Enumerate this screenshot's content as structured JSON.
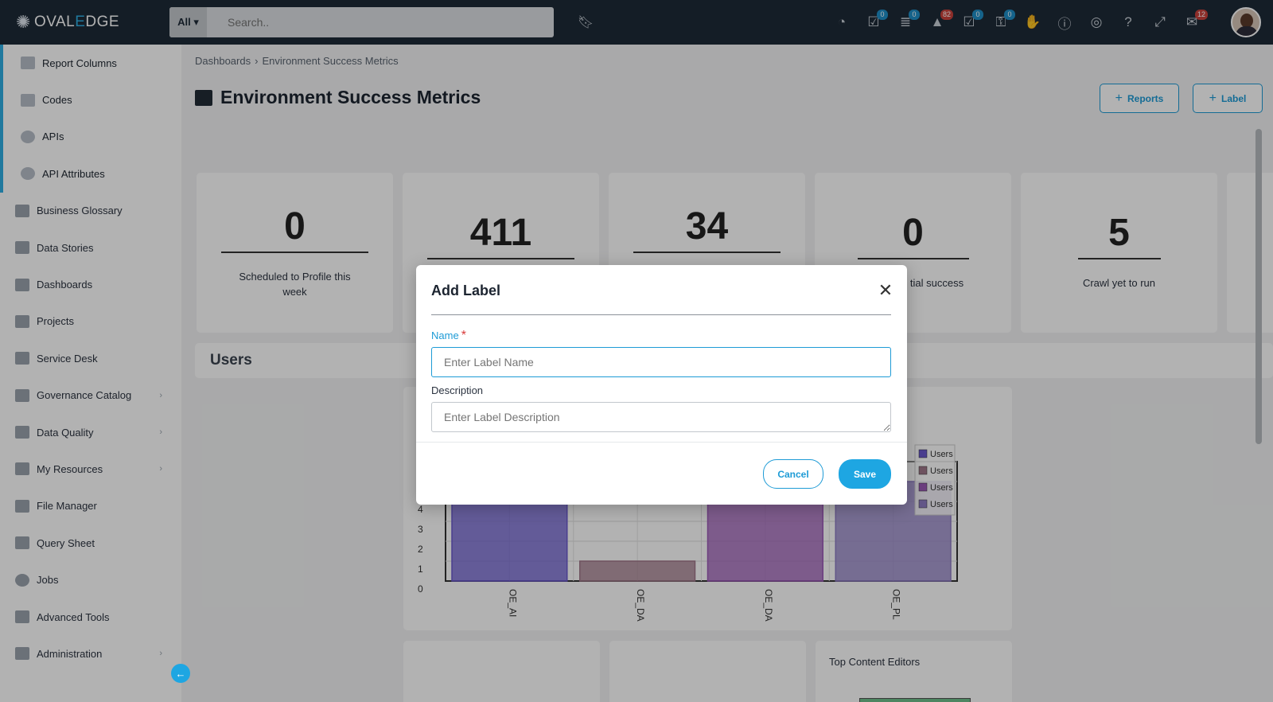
{
  "app": {
    "logo_prefix": "OVAL",
    "logo_e": "E",
    "logo_suffix": "DGE"
  },
  "search": {
    "scope": "All ▾",
    "placeholder": "Search.."
  },
  "top_icons": [
    {
      "name": "dashboard-meter-icon",
      "glyph": "◔",
      "count": ""
    },
    {
      "name": "tasks-icon",
      "glyph": "☑",
      "count": "0",
      "badge_color": "#1f8fc7"
    },
    {
      "name": "database-icon",
      "glyph": "≣",
      "count": "0",
      "badge_color": "#1f8fc7"
    },
    {
      "name": "alert-icon",
      "glyph": "▲",
      "count": "82",
      "badge_color": "#c9413b"
    },
    {
      "name": "approval-icon",
      "glyph": "☑",
      "count": "0",
      "badge_color": "#1f8fc7"
    },
    {
      "name": "lock-icon",
      "glyph": "⚿",
      "count": "0",
      "badge_color": "#1f8fc7"
    },
    {
      "name": "access-request-icon",
      "glyph": "✋",
      "count": ""
    },
    {
      "name": "info-icon",
      "glyph": "ⓘ",
      "count": ""
    },
    {
      "name": "chrome-icon",
      "glyph": "◎",
      "count": ""
    },
    {
      "name": "help-icon",
      "glyph": "?",
      "count": ""
    },
    {
      "name": "fullscreen-icon",
      "glyph": "⤢",
      "count": ""
    },
    {
      "name": "mail-icon",
      "glyph": "✉",
      "count": "12",
      "badge_color": "#c9413b"
    }
  ],
  "sidebar": {
    "sub_items": [
      {
        "label": "Report Columns",
        "icon": "report-columns-icon"
      },
      {
        "label": "Codes",
        "icon": "codes-icon"
      },
      {
        "label": "APIs",
        "icon": "api-icon"
      },
      {
        "label": "API Attributes",
        "icon": "api-attributes-icon"
      }
    ],
    "items": [
      {
        "label": "Business Glossary",
        "icon": "glossary-icon",
        "chevron": false
      },
      {
        "label": "Data Stories",
        "icon": "data-stories-icon",
        "chevron": false
      },
      {
        "label": "Dashboards",
        "icon": "dashboards-icon",
        "chevron": false
      },
      {
        "label": "Projects",
        "icon": "projects-icon",
        "chevron": false
      },
      {
        "label": "Service Desk",
        "icon": "service-desk-icon",
        "chevron": false
      },
      {
        "label": "Governance Catalog",
        "icon": "governance-icon",
        "chevron": true
      },
      {
        "label": "Data Quality",
        "icon": "data-quality-icon",
        "chevron": true
      },
      {
        "label": "My Resources",
        "icon": "my-resources-icon",
        "chevron": true
      },
      {
        "label": "File Manager",
        "icon": "file-manager-icon",
        "chevron": false
      },
      {
        "label": "Query Sheet",
        "icon": "query-sheet-icon",
        "chevron": false
      },
      {
        "label": "Jobs",
        "icon": "jobs-icon",
        "chevron": false
      },
      {
        "label": "Advanced Tools",
        "icon": "advanced-tools-icon",
        "chevron": false
      },
      {
        "label": "Administration",
        "icon": "administration-icon",
        "chevron": true
      }
    ],
    "collapse_glyph": "←"
  },
  "main": {
    "breadcrumb": [
      "Dashboards",
      "Environment Success Metrics"
    ],
    "breadcrumb_sep": "›",
    "title": "Environment Success Metrics",
    "reports_btn": "Reports",
    "label_btn": "Label",
    "plus": "+",
    "metrics": [
      {
        "value": "0",
        "label": "Scheduled to Profile this week"
      },
      {
        "value": "411",
        "label": ""
      },
      {
        "value": "34",
        "label": ""
      },
      {
        "value": "0",
        "label": "tial success"
      },
      {
        "value": "5",
        "label": "Crawl yet to run"
      }
    ],
    "users_title": "Users",
    "bottom_card_title": "Top Content Editors"
  },
  "chart_data": {
    "type": "bar",
    "categories": [
      "OE_AI",
      "OE_DA",
      "OE_DA",
      "OE_PL"
    ],
    "series": [
      {
        "name": "Users",
        "values": [
          5,
          0,
          0,
          0
        ],
        "color": "#6a5acd"
      },
      {
        "name": "Users",
        "values": [
          0,
          1,
          0,
          0
        ],
        "color": "#a0788a"
      },
      {
        "name": "Users",
        "values": [
          0,
          0,
          5,
          0
        ],
        "color": "#9b59b6"
      },
      {
        "name": "Users",
        "values": [
          0,
          0,
          0,
          5
        ],
        "color": "#8e7cc3"
      }
    ],
    "yticks": [
      "0",
      "1",
      "2",
      "3",
      "4"
    ],
    "ylim": [
      0,
      6
    ],
    "legend": "top-right"
  },
  "modal": {
    "title": "Add Label",
    "close_glyph": "✕",
    "name_label": "Name",
    "required_mark": "*",
    "name_placeholder": "Enter Label Name",
    "description_label": "Description",
    "description_placeholder": "Enter Label Description",
    "cancel": "Cancel",
    "save": "Save"
  }
}
